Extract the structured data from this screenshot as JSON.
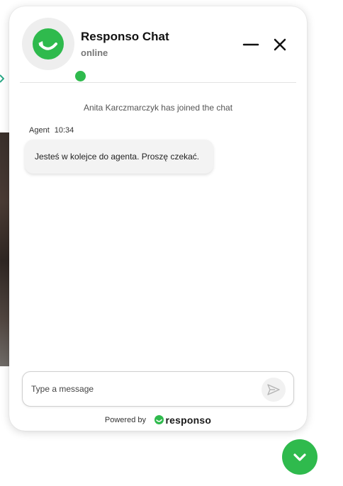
{
  "header": {
    "title": "Responso Chat",
    "status": "online"
  },
  "messages": {
    "system": "Anita Karczmarczyk has joined the chat",
    "agent_message": {
      "sender": "Agent",
      "time": "10:34",
      "text": "Jesteś w kolejce do agenta. Proszę czekać."
    }
  },
  "composer": {
    "placeholder": "Type a message",
    "value": ""
  },
  "footer": {
    "powered_label": "Powered by",
    "brand_name": "responso"
  },
  "icons": {
    "avatar": "responso-logo-icon",
    "minimize": "minimize-icon",
    "close": "close-icon",
    "send": "send-icon",
    "toggle": "chevron-down-icon"
  },
  "colors": {
    "brand_green": "#2fba4d",
    "bubble_bg": "#f3f3f3",
    "avatar_bg": "#eeeeee"
  }
}
